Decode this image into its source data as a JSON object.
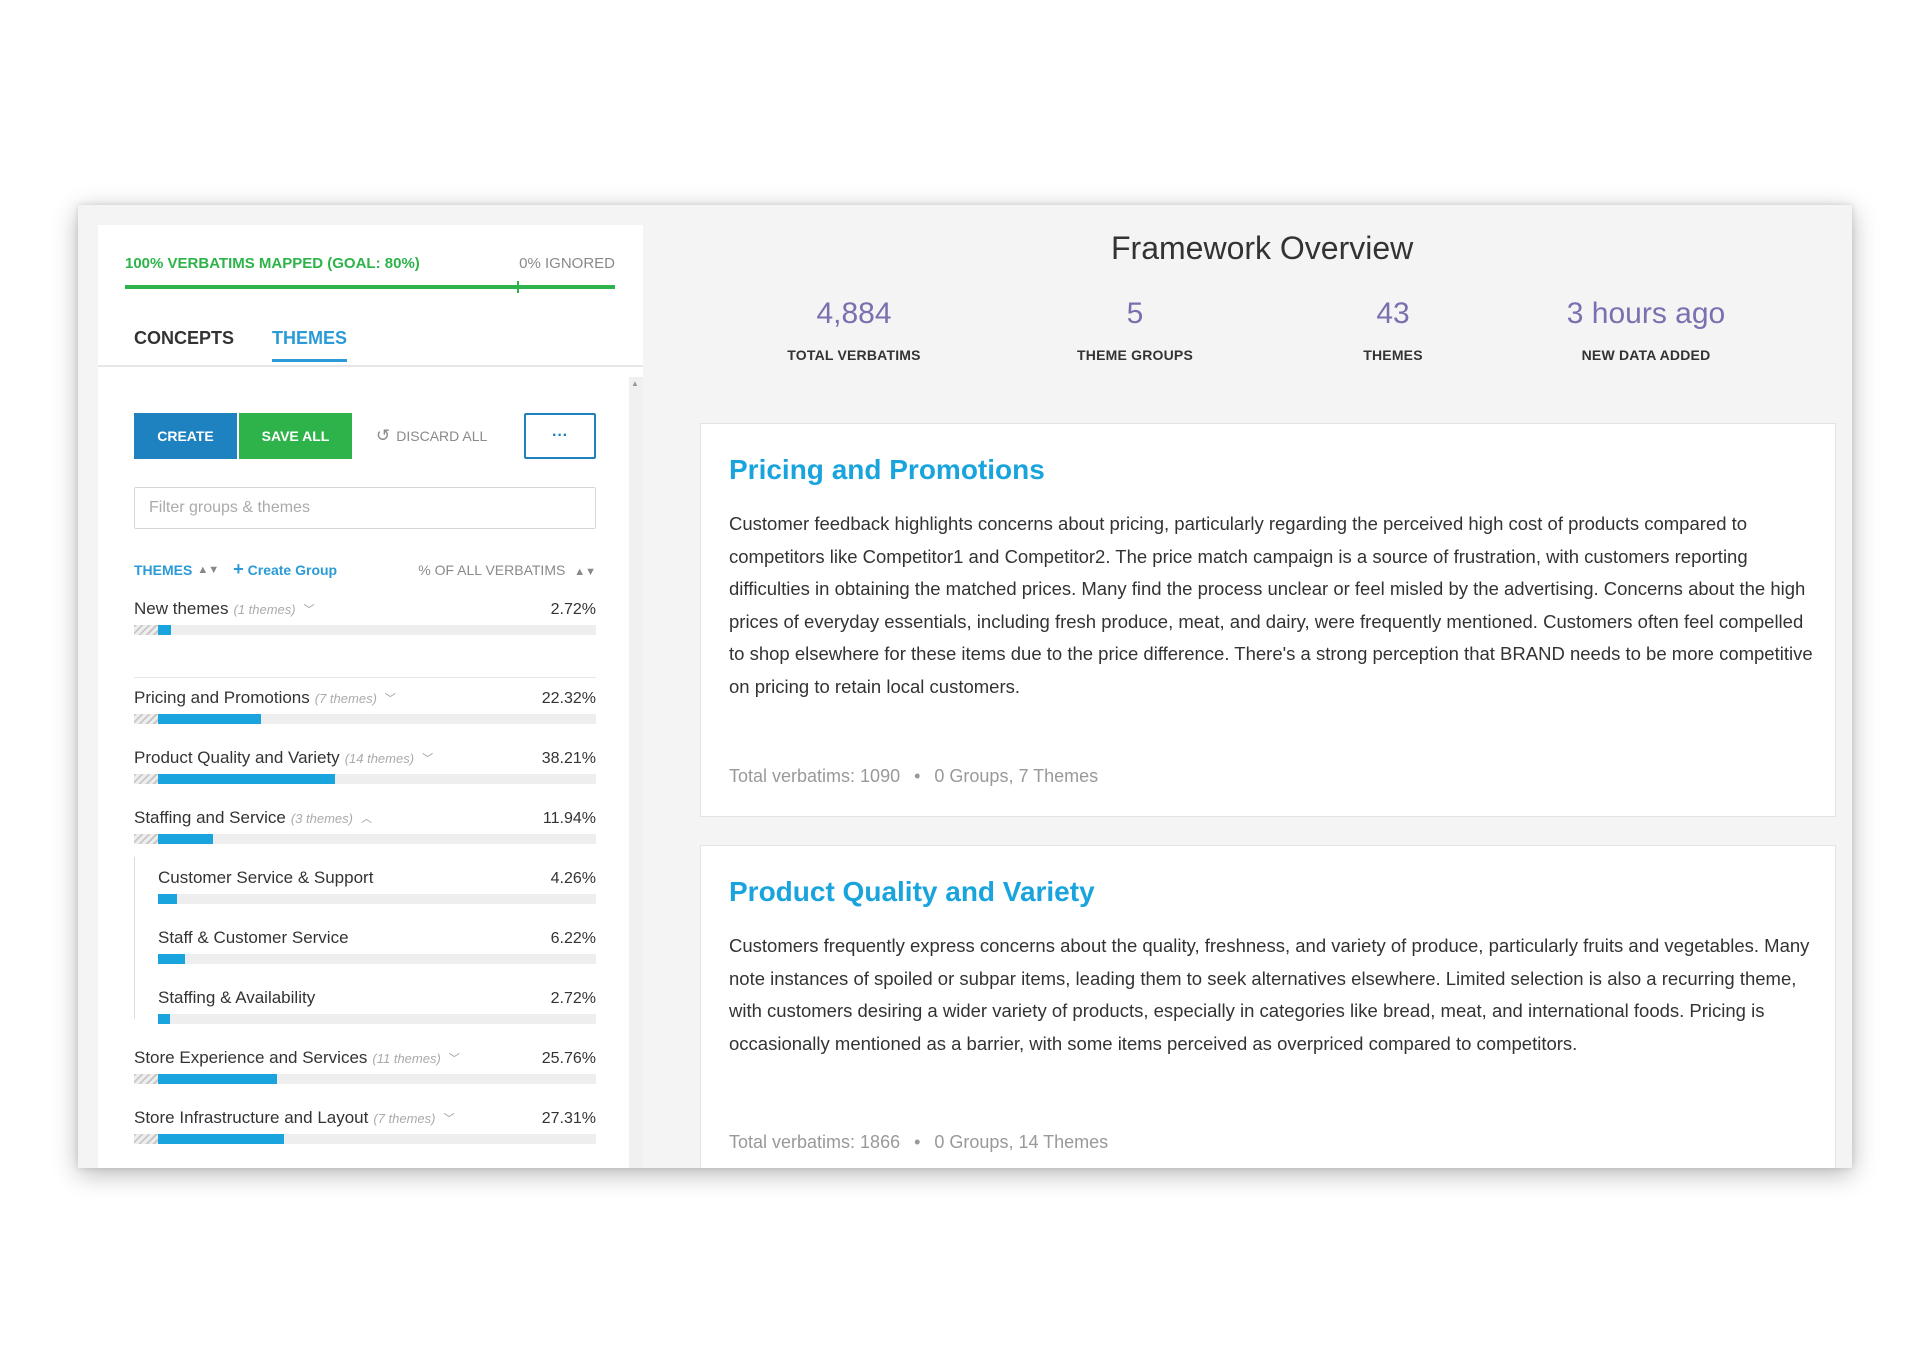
{
  "mapping": {
    "mapped_label": "100% VERBATIMS MAPPED (GOAL: 80%)",
    "ignored_label": "0% IGNORED",
    "mapped_percent": 100,
    "goal_percent": 80
  },
  "tabs": [
    {
      "label": "CONCEPTS",
      "active": false
    },
    {
      "label": "THEMES",
      "active": true
    }
  ],
  "toolbar": {
    "create_label": "CREATE",
    "save_all_label": "SAVE ALL",
    "discard_all_label": "DISCARD ALL",
    "more_label": "···"
  },
  "filter": {
    "placeholder": "Filter groups & themes",
    "value": ""
  },
  "list_header": {
    "themes_label": "THEMES",
    "create_group_label": "Create Group",
    "percent_label": "% OF ALL VERBATIMS"
  },
  "groups": [
    {
      "label": "New themes",
      "count": "(1 themes)",
      "percent": "2.72%",
      "value": 2.72,
      "expanded": false
    },
    {
      "label": "Pricing and Promotions",
      "count": "(7 themes)",
      "percent": "22.32%",
      "value": 22.32,
      "expanded": false
    },
    {
      "label": "Product Quality and Variety",
      "count": "(14 themes)",
      "percent": "38.21%",
      "value": 38.21,
      "expanded": false
    },
    {
      "label": "Staffing and Service",
      "count": "(3 themes)",
      "percent": "11.94%",
      "value": 11.94,
      "expanded": true,
      "children": [
        {
          "label": "Customer Service & Support",
          "percent": "4.26%",
          "value": 4.26
        },
        {
          "label": "Staff & Customer Service",
          "percent": "6.22%",
          "value": 6.22
        },
        {
          "label": "Staffing & Availability",
          "percent": "2.72%",
          "value": 2.72
        }
      ]
    },
    {
      "label": "Store Experience and Services",
      "count": "(11 themes)",
      "percent": "25.76%",
      "value": 25.76,
      "expanded": false
    },
    {
      "label": "Store Infrastructure and Layout",
      "count": "(7 themes)",
      "percent": "27.31%",
      "value": 27.31,
      "expanded": false
    }
  ],
  "overview": {
    "title": "Framework Overview",
    "stats": [
      {
        "value": "4,884",
        "label": "TOTAL VERBATIMS"
      },
      {
        "value": "5",
        "label": "THEME GROUPS"
      },
      {
        "value": "43",
        "label": "THEMES"
      },
      {
        "value": "3 hours ago",
        "label": "NEW DATA ADDED"
      }
    ]
  },
  "cards": [
    {
      "title": "Pricing and Promotions",
      "text": "Customer feedback highlights concerns about pricing, particularly regarding the perceived high cost of products compared to competitors like Competitor1 and Competitor2. The price match campaign is a source of frustration, with customers reporting difficulties in obtaining the matched prices. Many find the process unclear or feel misled by the advertising. Concerns about the high prices of everyday essentials, including fresh produce, meat, and dairy, were frequently mentioned. Customers often feel compelled to shop elsewhere for these items due to the price difference. There's a strong perception that BRAND needs to be more competitive on pricing to retain local customers.",
      "total": "Total verbatims: 1090",
      "groups_themes": "0 Groups, 7 Themes"
    },
    {
      "title": "Product Quality and Variety",
      "text": "Customers frequently express concerns about the quality, freshness, and variety of produce, particularly fruits and vegetables. Many note instances of spoiled or subpar items, leading them to seek alternatives elsewhere. Limited selection is also a recurring theme, with customers desiring a wider variety of products, especially in categories like bread, meat, and international foods. Pricing is occasionally mentioned as a barrier, with some items perceived as overpriced compared to competitors.",
      "total": "Total verbatims: 1866",
      "groups_themes": "0 Groups, 14 Themes"
    }
  ],
  "colors": {
    "accent_blue": "#1aa4dd",
    "primary_button": "#1f82c0",
    "success_green": "#2db34a",
    "stat_purple": "#7b6fb0"
  }
}
